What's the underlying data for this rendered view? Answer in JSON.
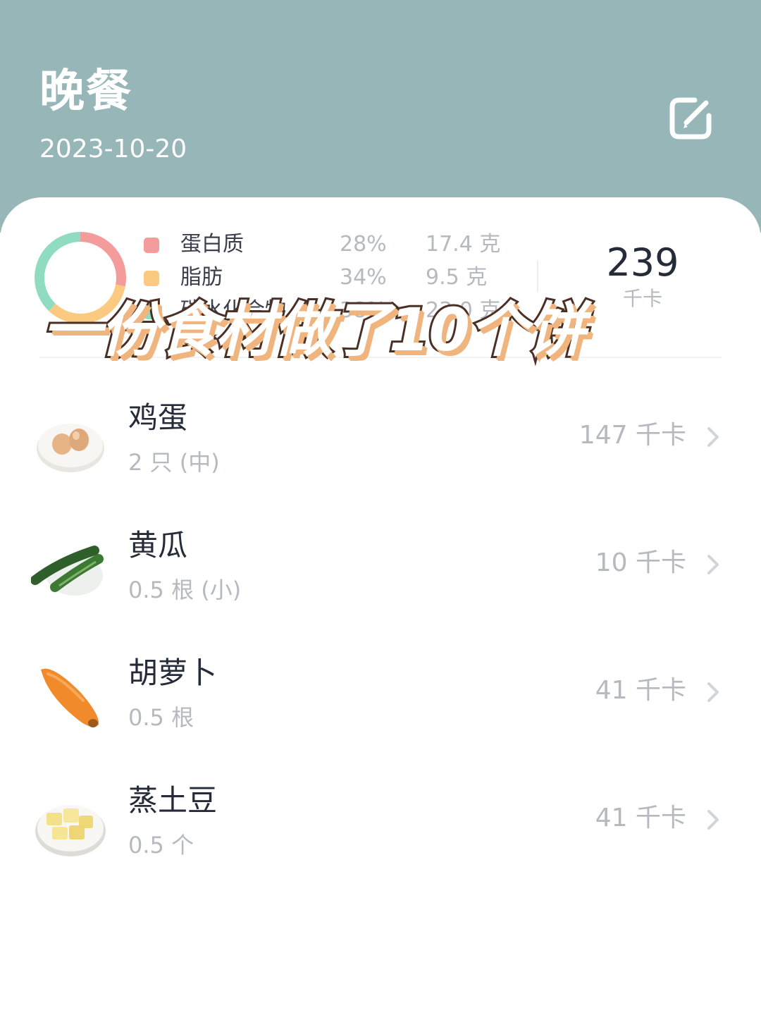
{
  "header": {
    "title": "晚餐",
    "date": "2023-10-20",
    "edit_icon": "edit-icon"
  },
  "summary": {
    "macros": [
      {
        "name": "蛋白质",
        "percent": "28%",
        "amount": "17.4 克",
        "color": "#f49b9b",
        "fraction": 0.28
      },
      {
        "name": "脂肪",
        "percent": "34%",
        "amount": "9.5 克",
        "color": "#fbc97f",
        "fraction": 0.34
      },
      {
        "name": "碳水化合物",
        "percent": "38%",
        "amount": "23.0 克",
        "color": "#8fdcc0",
        "fraction": 0.38
      }
    ],
    "total_kcal": "239",
    "total_unit": "千卡"
  },
  "overlay_caption": "一份食材做了10个饼",
  "foods": [
    {
      "name": "鸡蛋",
      "qty": "2 只 (中)",
      "kcal": "147 千卡",
      "icon": "egg-icon"
    },
    {
      "name": "黄瓜",
      "qty": "0.5 根 (小)",
      "kcal": "10 千卡",
      "icon": "cucumber-icon"
    },
    {
      "name": "胡萝卜",
      "qty": "0.5 根",
      "kcal": "41 千卡",
      "icon": "carrot-icon"
    },
    {
      "name": "蒸土豆",
      "qty": "0.5 个",
      "kcal": "41 千卡",
      "icon": "potato-icon"
    }
  ],
  "colors": {
    "header_bg": "#97b6b8",
    "text_primary": "#262b3a",
    "text_secondary": "#b6b9c0"
  }
}
